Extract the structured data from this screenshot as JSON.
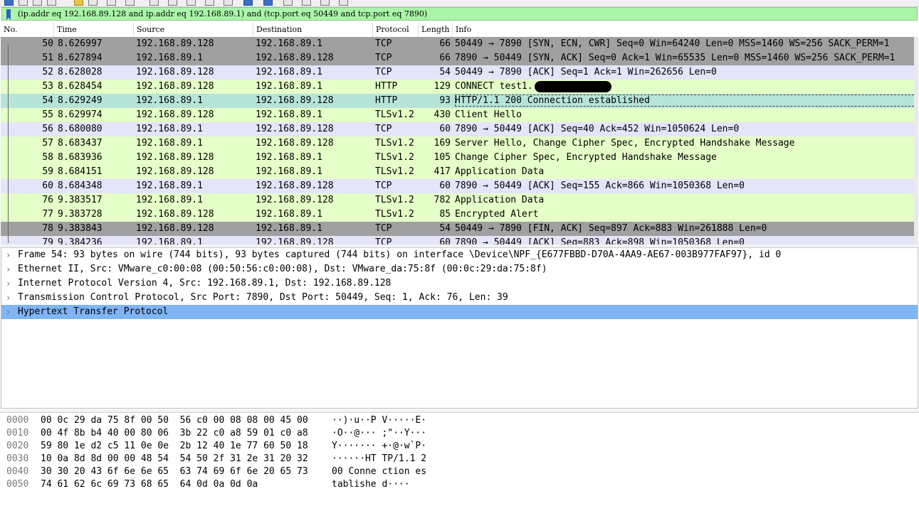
{
  "display_filter": {
    "value": "(ip.addr eq 192.168.89.128 and ip.addr eq 192.168.89.1) and (tcp.port eq 50449 and tcp.port eq 7890)"
  },
  "packet_list": {
    "columns": [
      "No.",
      "Time",
      "Source",
      "Destination",
      "Protocol",
      "Length",
      "Info"
    ],
    "rows": [
      {
        "no": "50",
        "time": "8.626997",
        "src": "192.168.89.128",
        "dst": "192.168.89.1",
        "proto": "TCP",
        "len": "66",
        "info": "50449 → 7890 [SYN, ECN, CWR] Seq=0 Win=64240 Len=0 MSS=1460 WS=256 SACK_PERM=1",
        "color": "gray"
      },
      {
        "no": "51",
        "time": "8.627894",
        "src": "192.168.89.1",
        "dst": "192.168.89.128",
        "proto": "TCP",
        "len": "66",
        "info": "7890 → 50449 [SYN, ACK] Seq=0 Ack=1 Win=65535 Len=0 MSS=1460 WS=256 SACK_PERM=1",
        "color": "gray"
      },
      {
        "no": "52",
        "time": "8.628028",
        "src": "192.168.89.128",
        "dst": "192.168.89.1",
        "proto": "TCP",
        "len": "54",
        "info": "50449 → 7890 [ACK] Seq=1 Ack=1 Win=262656 Len=0",
        "color": "lilac"
      },
      {
        "no": "53",
        "time": "8.628454",
        "src": "192.168.89.128",
        "dst": "192.168.89.1",
        "proto": "HTTP",
        "len": "129",
        "info": "CONNECT test1.                    :443 HTTP/1.1",
        "color": "lime",
        "redacted": true
      },
      {
        "no": "54",
        "time": "8.629249",
        "src": "192.168.89.1",
        "dst": "192.168.89.128",
        "proto": "HTTP",
        "len": "93",
        "info": "HTTP/1.1 200 Connection established",
        "color": "sel",
        "selected": true
      },
      {
        "no": "55",
        "time": "8.629974",
        "src": "192.168.89.128",
        "dst": "192.168.89.1",
        "proto": "TLSv1.2",
        "len": "430",
        "info": "Client Hello",
        "color": "lime"
      },
      {
        "no": "56",
        "time": "8.680080",
        "src": "192.168.89.1",
        "dst": "192.168.89.128",
        "proto": "TCP",
        "len": "60",
        "info": "7890 → 50449 [ACK] Seq=40 Ack=452 Win=1050624 Len=0",
        "color": "lilac"
      },
      {
        "no": "57",
        "time": "8.683437",
        "src": "192.168.89.1",
        "dst": "192.168.89.128",
        "proto": "TLSv1.2",
        "len": "169",
        "info": "Server Hello, Change Cipher Spec, Encrypted Handshake Message",
        "color": "lime"
      },
      {
        "no": "58",
        "time": "8.683936",
        "src": "192.168.89.128",
        "dst": "192.168.89.1",
        "proto": "TLSv1.2",
        "len": "105",
        "info": "Change Cipher Spec, Encrypted Handshake Message",
        "color": "lime"
      },
      {
        "no": "59",
        "time": "8.684151",
        "src": "192.168.89.128",
        "dst": "192.168.89.1",
        "proto": "TLSv1.2",
        "len": "417",
        "info": "Application Data",
        "color": "lime"
      },
      {
        "no": "60",
        "time": "8.684348",
        "src": "192.168.89.1",
        "dst": "192.168.89.128",
        "proto": "TCP",
        "len": "60",
        "info": "7890 → 50449 [ACK] Seq=155 Ack=866 Win=1050368 Len=0",
        "color": "lilac"
      },
      {
        "no": "76",
        "time": "9.383517",
        "src": "192.168.89.1",
        "dst": "192.168.89.128",
        "proto": "TLSv1.2",
        "len": "782",
        "info": "Application Data",
        "color": "lime"
      },
      {
        "no": "77",
        "time": "9.383728",
        "src": "192.168.89.128",
        "dst": "192.168.89.1",
        "proto": "TLSv1.2",
        "len": "85",
        "info": "Encrypted Alert",
        "color": "lime"
      },
      {
        "no": "78",
        "time": "9.383843",
        "src": "192.168.89.128",
        "dst": "192.168.89.1",
        "proto": "TCP",
        "len": "54",
        "info": "50449 → 7890 [FIN, ACK] Seq=897 Ack=883 Win=261888 Len=0",
        "color": "gray"
      },
      {
        "no": "79",
        "time": "9.384236",
        "src": "192.168.89.1",
        "dst": "192.168.89.128",
        "proto": "TCP",
        "len": "60",
        "info": "7890 → 50449 [ACK] Seq=883 Ack=898 Win=1050368 Len=0",
        "color": "lilac"
      }
    ]
  },
  "packet_details": [
    {
      "text": "Frame 54: 93 bytes on wire (744 bits), 93 bytes captured (744 bits) on interface \\Device\\NPF_{E677FBBD-D70A-4AA9-AE67-003B977FAF97}, id 0"
    },
    {
      "text": "Ethernet II, Src: VMware_c0:00:08 (00:50:56:c0:00:08), Dst: VMware_da:75:8f (00:0c:29:da:75:8f)"
    },
    {
      "text": "Internet Protocol Version 4, Src: 192.168.89.1, Dst: 192.168.89.128"
    },
    {
      "text": "Transmission Control Protocol, Src Port: 7890, Dst Port: 50449, Seq: 1, Ack: 76, Len: 39"
    },
    {
      "text": "Hypertext Transfer Protocol",
      "active": true
    }
  ],
  "packet_bytes": [
    {
      "offset": "0000",
      "hex": "00 0c 29 da 75 8f 00 50  56 c0 00 08 08 00 45 00",
      "ascii": "··)·u··P V·····E·"
    },
    {
      "offset": "0010",
      "hex": "00 4f 8b b4 40 00 80 06  3b 22 c0 a8 59 01 c0 a8",
      "ascii": "·O··@··· ;\"··Y···"
    },
    {
      "offset": "0020",
      "hex": "59 80 1e d2 c5 11 0e 0e  2b 12 40 1e 77 60 50 18",
      "ascii": "Y······· +·@·w`P·"
    },
    {
      "offset": "0030",
      "hex": "10 0a 8d 8d 00 00 48 54  54 50 2f 31 2e 31 20 32",
      "ascii": "······HT TP/1.1 2"
    },
    {
      "offset": "0040",
      "hex": "30 30 20 43 6f 6e 6e 65  63 74 69 6f 6e 20 65 73",
      "ascii": "00 Conne ction es"
    },
    {
      "offset": "0050",
      "hex": "74 61 62 6c 69 73 68 65  64 0d 0a 0d 0a",
      "ascii": "tablishe d····"
    }
  ],
  "icons": {
    "filter_bookmark": "bookmark-icon",
    "tree_collapsed": "chevron-right-icon"
  },
  "colors": {
    "filter_valid": "#aaf5a8",
    "row_gray": "#a0a0a0",
    "row_tcp": "#e4e4fa",
    "row_http_tls": "#e4ffc7",
    "row_selected": "#b7e4d8",
    "detail_selected": "#7fb4f5"
  }
}
